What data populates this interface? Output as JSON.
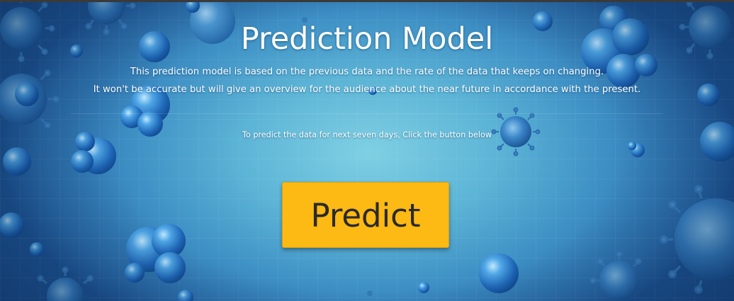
{
  "header": {
    "title": "Prediction Model",
    "description_line1": "This prediction model is based on the previous data and the rate of the data that keeps on changing.",
    "description_line2": "It won't be accurate but will give an overview for the audience about the near future in accordance with the present."
  },
  "main": {
    "instruction": "To predict the data for next seven days, Click the button below",
    "predict_button_label": "Predict"
  },
  "colors": {
    "button_background": "#fdb914",
    "button_text": "#2a2a2a",
    "text": "#ffffff",
    "background_center": "#7fd0e3",
    "background_edge": "#1e5594"
  },
  "background": {
    "image": "blue virus cells illustration"
  }
}
